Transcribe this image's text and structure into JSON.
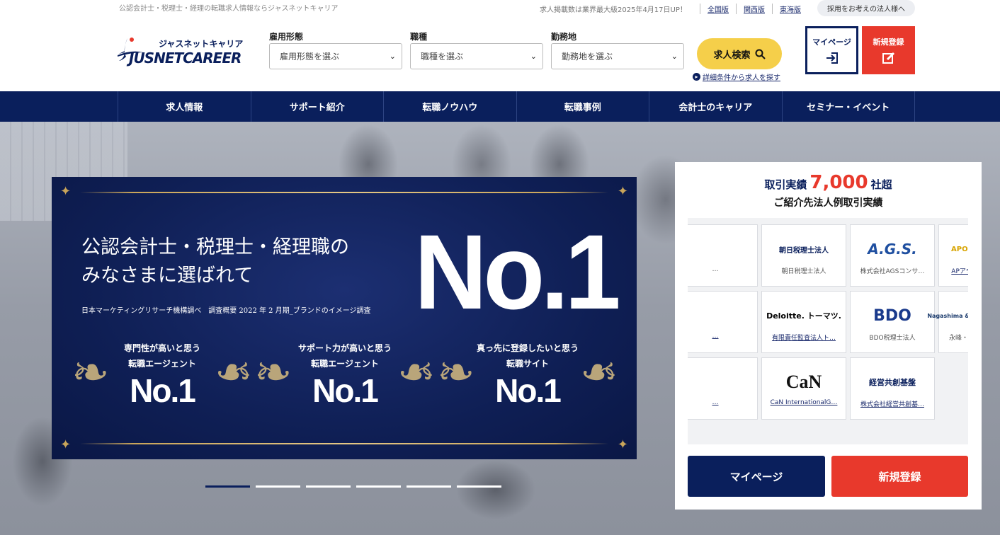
{
  "header": {
    "tagline": "公認会計士・税理士・経理の転職求人情報ならジャスネットキャリア",
    "notice": "求人掲載数は業界最大級2025年4月17日UP！",
    "region_links": [
      "全国版",
      "関西版",
      "東海版"
    ],
    "corporate_button": "採用をお考えの法人様へ",
    "logo_kana": "ジャスネットキャリア",
    "logo_text": "JUSNETCAREER",
    "selects": [
      {
        "label": "雇用形態",
        "placeholder": "雇用形態を選ぶ"
      },
      {
        "label": "職種",
        "placeholder": "職種を選ぶ"
      },
      {
        "label": "勤務地",
        "placeholder": "勤務地を選ぶ"
      }
    ],
    "search_button": "求人検索",
    "detail_link": "詳細条件から求人を探す",
    "mypage_button": "マイページ",
    "register_button": "新規登録"
  },
  "nav": [
    "求人情報",
    "サポート紹介",
    "転職ノウハウ",
    "転職事例",
    "会計士のキャリア",
    "セミナー・イベント"
  ],
  "banner": {
    "headline_1": "公認会計士・税理士・経理職の",
    "headline_2": "みなさまに選ばれて",
    "big_no1": "No.1",
    "survey": "日本マーケティングリサーチ機構調べ　調査概要 2022 年 2 月期_ブランドのイメージ調査",
    "awards": [
      {
        "line1": "専門性が高いと思う",
        "line2": "転職エージェント",
        "no1": "No.1"
      },
      {
        "line1": "サポート力が高いと思う",
        "line2": "転職エージェント",
        "no1": "No.1"
      },
      {
        "line1": "真っ先に登録したいと思う",
        "line2": "転職サイト",
        "no1": "No.1"
      }
    ]
  },
  "slider": {
    "count": 6,
    "active": 0
  },
  "panel": {
    "title_prefix": "取引実績",
    "title_number": "7,000",
    "title_suffix": "社超",
    "subtitle": "ご紹介先法人例取引実績",
    "companies": [
      {
        "logo": "",
        "name": "…",
        "link": false
      },
      {
        "logo": "朝日税理士法人",
        "name": "朝日税理士法人",
        "link": false
      },
      {
        "logo": "A.G.S.",
        "name": "株式会社AGSコンサ…",
        "link": false
      },
      {
        "logo": "APOutsourcing",
        "name": "APアウトソーシン…",
        "link": true
      },
      {
        "logo": "",
        "name": "…",
        "link": true
      },
      {
        "logo": "Deloitte. トーマツ.",
        "name": "有限責任監査法人ト…",
        "link": true
      },
      {
        "logo": "BDO",
        "name": "BDO税理士法人",
        "link": false
      },
      {
        "logo": "Nagashima & Mishima Consulting",
        "name": "永峰・三島コンサル…",
        "link": false
      },
      {
        "logo": "",
        "name": "…",
        "link": true
      },
      {
        "logo": "CaN",
        "name": "CaN InternationalG…",
        "link": true
      },
      {
        "logo": "経営共創基盤",
        "name": "株式会社経営共創基…",
        "link": true
      }
    ],
    "dots": {
      "count": 6,
      "active": 5
    },
    "mypage_button": "マイページ",
    "register_button": "新規登録"
  },
  "colors": {
    "navy": "#0a1f5c",
    "red": "#e8392c",
    "yellow": "#f5cf4a",
    "gold": "#c9a55a"
  }
}
